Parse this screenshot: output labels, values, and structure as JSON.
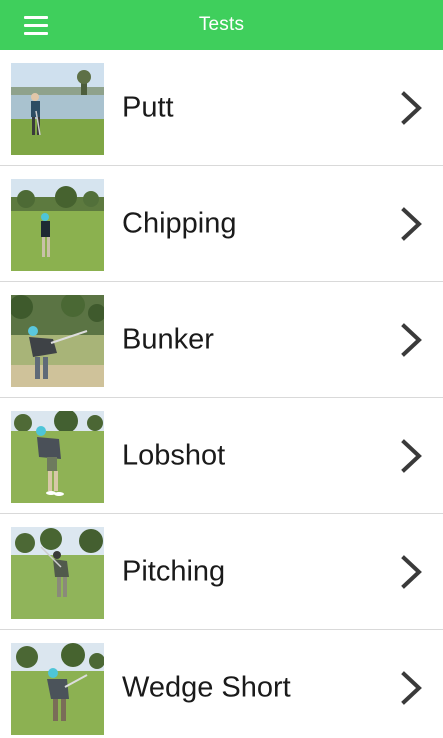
{
  "header": {
    "title": "Tests",
    "menu_icon": "hamburger-menu-icon",
    "background_color": "#3fcf5c"
  },
  "tests": [
    {
      "label": "Putt",
      "thumbnail": "golfer-putting-photo"
    },
    {
      "label": "Chipping",
      "thumbnail": "golfer-chipping-photo"
    },
    {
      "label": "Bunker",
      "thumbnail": "golfer-bunker-photo"
    },
    {
      "label": "Lobshot",
      "thumbnail": "golfer-lobshot-photo"
    },
    {
      "label": "Pitching",
      "thumbnail": "golfer-pitching-photo"
    },
    {
      "label": "Wedge Short",
      "thumbnail": "golfer-wedge-short-photo"
    }
  ],
  "row_icon": "chevron-right-icon"
}
